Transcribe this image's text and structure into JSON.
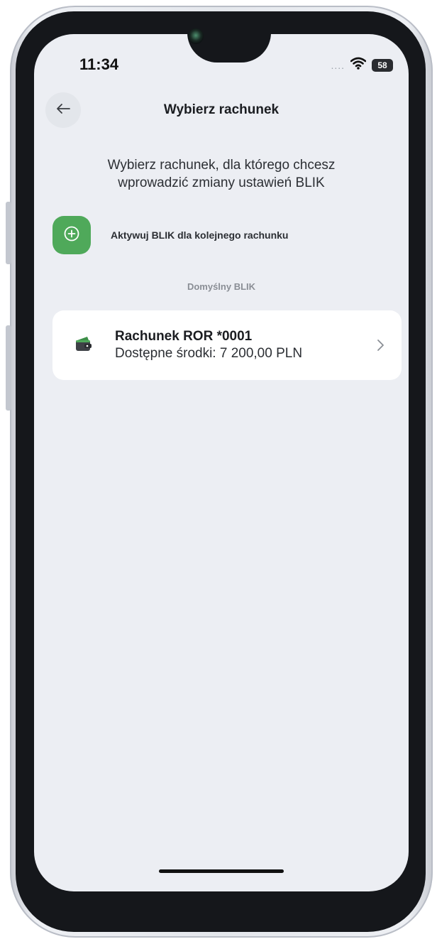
{
  "status_bar": {
    "time": "11:34",
    "signal": "....",
    "battery": "58",
    "wifi_icon": "wifi-icon"
  },
  "header": {
    "back_icon": "arrow-left-icon",
    "title": "Wybierz rachunek"
  },
  "instruction": "Wybierz rachunek, dla którego chcesz wprowadzić zmiany ustawień BLIK",
  "activate": {
    "icon": "plus-circle-icon",
    "label": "Aktywuj BLIK dla kolejnego rachunku"
  },
  "section_label": "Domyślny BLIK",
  "account": {
    "icon": "wallet-icon",
    "name": "Rachunek ROR *0001",
    "balance": "Dostępne środki: 7 200,00 PLN",
    "chevron_icon": "chevron-right-icon"
  },
  "colors": {
    "accent": "#4fa95a",
    "screen_background": "#eceef3",
    "card_background": "#ffffff"
  }
}
